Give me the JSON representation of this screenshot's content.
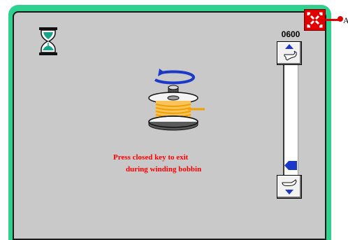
{
  "screen": {
    "counter_value": "0600",
    "message_line1": "Press closed key to exit",
    "message_line2": "during winding bobbin",
    "callout_label": "A"
  },
  "icons": {
    "status": "hourglass-icon",
    "close": "close-key-icon",
    "speed_up": "speed-up-icon",
    "speed_down": "speed-down-icon",
    "illustration": "bobbin-winding-icon"
  },
  "colors": {
    "frame": "#2fd18f",
    "panel": "#c9c9c9",
    "close_key": "#e00000",
    "message_text": "#ff0000",
    "thread": "#f0a000",
    "rotation_arrow": "#1c38c8"
  },
  "slider": {
    "level_fraction": 0.12
  }
}
